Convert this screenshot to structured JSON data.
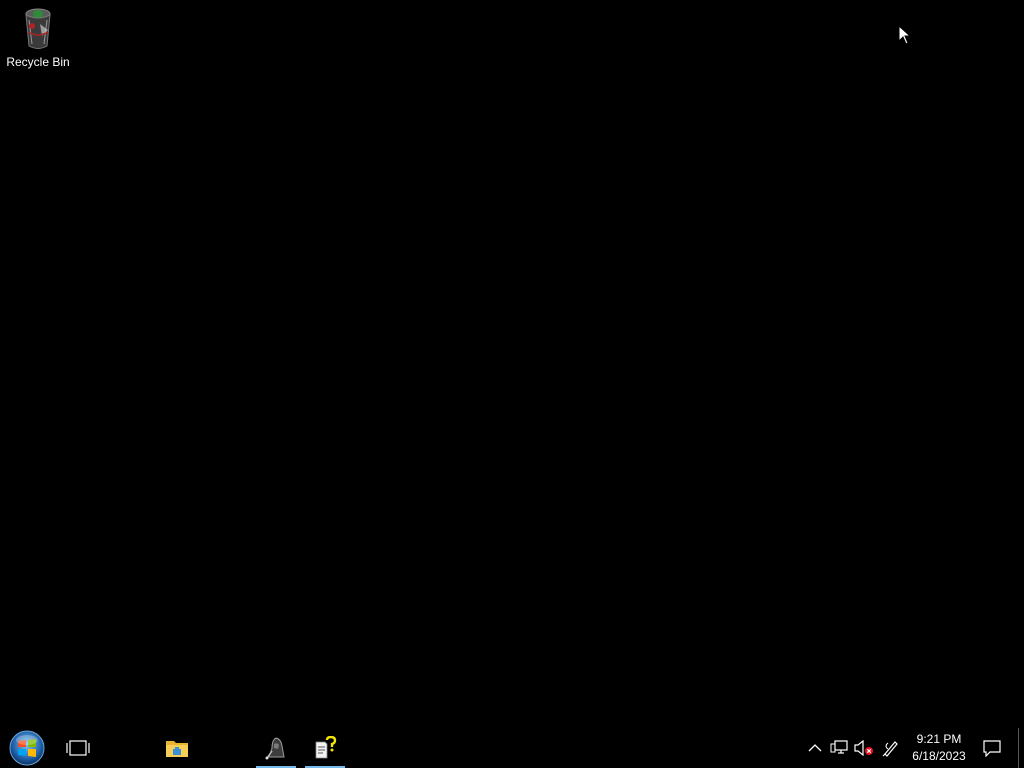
{
  "desktop": {
    "icons": [
      {
        "label": "Recycle Bin",
        "icon": "recycle-bin-icon"
      }
    ]
  },
  "taskbar": {
    "start_icon": "windows-start-orb-icon",
    "task_view_icon": "task-view-icon",
    "pinned": [
      {
        "icon": "file-explorer-icon",
        "running": false
      },
      {
        "icon": "app-figure-icon",
        "running": true
      },
      {
        "icon": "help-document-icon",
        "running": true
      }
    ],
    "tray": {
      "chevron_icon": "chevron-up-icon",
      "network_icon": "network-icon",
      "volume_icon": "volume-muted-icon",
      "pen_icon": "pen-icon",
      "time": "9:21 PM",
      "date": "6/18/2023",
      "action_center_icon": "action-center-icon"
    }
  },
  "colors": {
    "desktop_background": "#000000",
    "taskbar_background": "#000000",
    "running_indicator": "#76b9ed",
    "text": "#ffffff"
  }
}
